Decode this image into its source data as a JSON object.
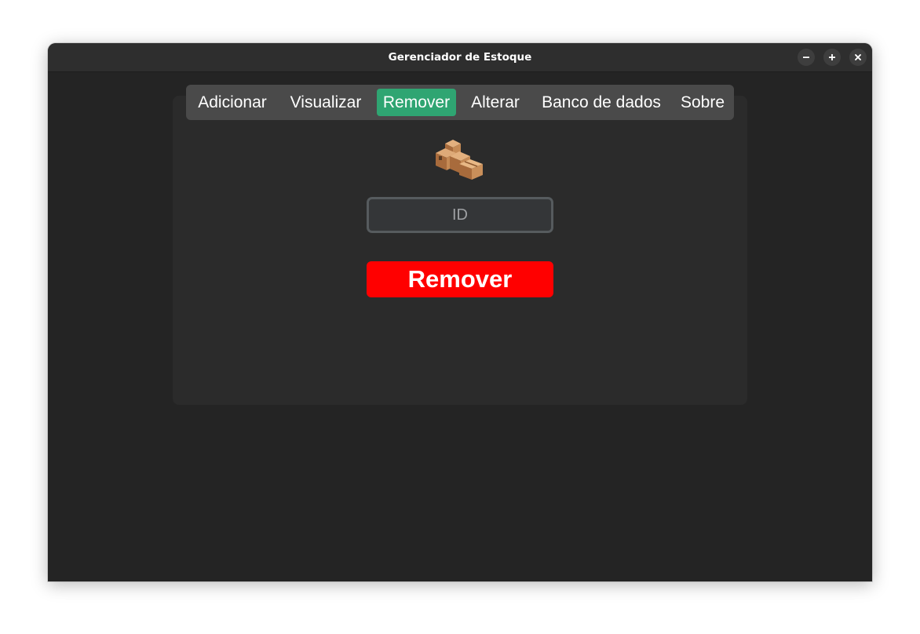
{
  "window": {
    "title": "Gerenciador de Estoque",
    "controls": {
      "minimize": "minimize-icon",
      "maximize": "maximize-icon",
      "close": "close-icon"
    }
  },
  "tabs": [
    {
      "label": "Adicionar",
      "active": false
    },
    {
      "label": "Visualizar",
      "active": false
    },
    {
      "label": "Remover",
      "active": true
    },
    {
      "label": "Alterar",
      "active": false
    },
    {
      "label": "Banco de dados",
      "active": false
    },
    {
      "label": "Sobre",
      "active": false
    }
  ],
  "main": {
    "icon": "boxes-icon",
    "id_input": {
      "placeholder": "ID",
      "value": ""
    },
    "remove_button": "Remover"
  },
  "colors": {
    "window_bg": "#242424",
    "panel_bg": "#2b2b2b",
    "tabbar_bg": "#4a4a4a",
    "active_tab": "#2fa572",
    "remove_button": "#ff0000",
    "input_bg": "#343638",
    "input_border": "#565b5e"
  }
}
